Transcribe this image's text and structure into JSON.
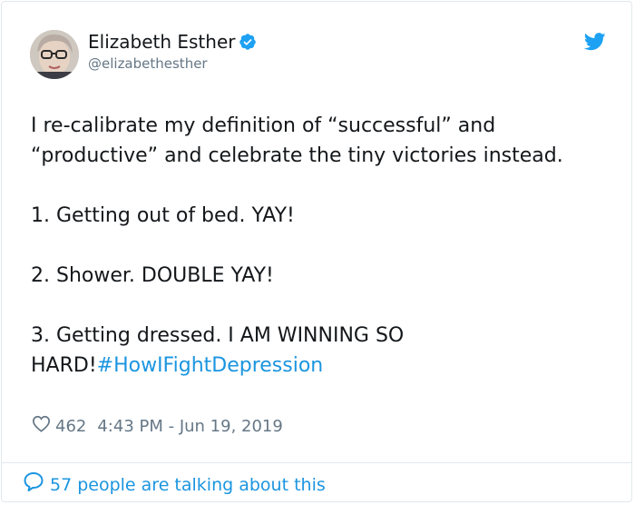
{
  "author": {
    "name": "Elizabeth Esther",
    "handle": "@elizabethesther",
    "verified_icon": "verified-badge-icon",
    "avatar": "profile-photo"
  },
  "brand_icon": "twitter-bird-icon",
  "tweet": {
    "paragraph1": "I re-calibrate my definition of “successful” and “productive” and celebrate the tiny victories instead.",
    "item1": "1. Getting out of bed. YAY!",
    "item2": "2. Shower. DOUBLE YAY!",
    "item3_prefix": "3. Getting dressed. I AM WINNING SO HARD!",
    "hashtag": "#HowIFightDepression"
  },
  "meta": {
    "likes": "462",
    "timestamp": "4:43 PM - Jun 19, 2019"
  },
  "footer": {
    "talking": "57 people are talking about this"
  },
  "colors": {
    "accent": "#1b95e0",
    "text": "#14171a",
    "muted": "#657786",
    "border": "#e1e8ed"
  }
}
